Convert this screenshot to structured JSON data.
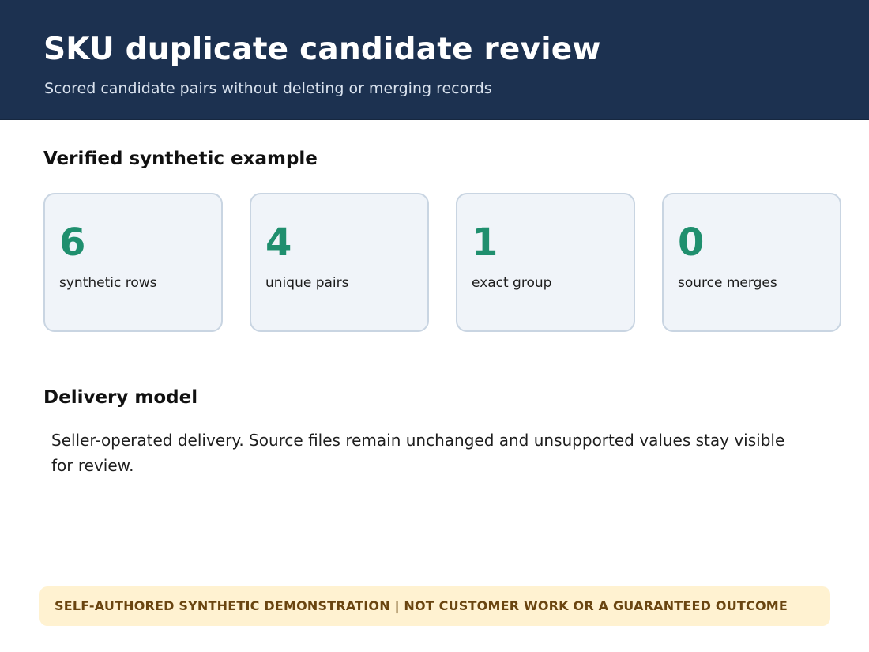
{
  "header": {
    "title": "SKU duplicate candidate review",
    "subtitle": "Scored candidate pairs without deleting or merging records"
  },
  "verified": {
    "heading": "Verified synthetic example",
    "metrics": [
      {
        "value": "6",
        "label": "synthetic rows"
      },
      {
        "value": "4",
        "label": "unique pairs"
      },
      {
        "value": "1",
        "label": "exact group"
      },
      {
        "value": "0",
        "label": "source merges"
      }
    ]
  },
  "delivery": {
    "heading": "Delivery model",
    "text": "Seller-operated delivery. Source files remain unchanged and unsupported values stay visible for review."
  },
  "disclaimer": {
    "text": "SELF-AUTHORED SYNTHETIC DEMONSTRATION  |  NOT CUSTOMER WORK OR A GUARANTEED OUTCOME"
  },
  "colors": {
    "header_bg": "#1c3150",
    "metric_value": "#1f8f6e",
    "card_bg": "#f0f4f9",
    "card_border": "#c9d5e2",
    "disclaimer_bg": "#fff2d1",
    "disclaimer_text": "#6a4510"
  }
}
